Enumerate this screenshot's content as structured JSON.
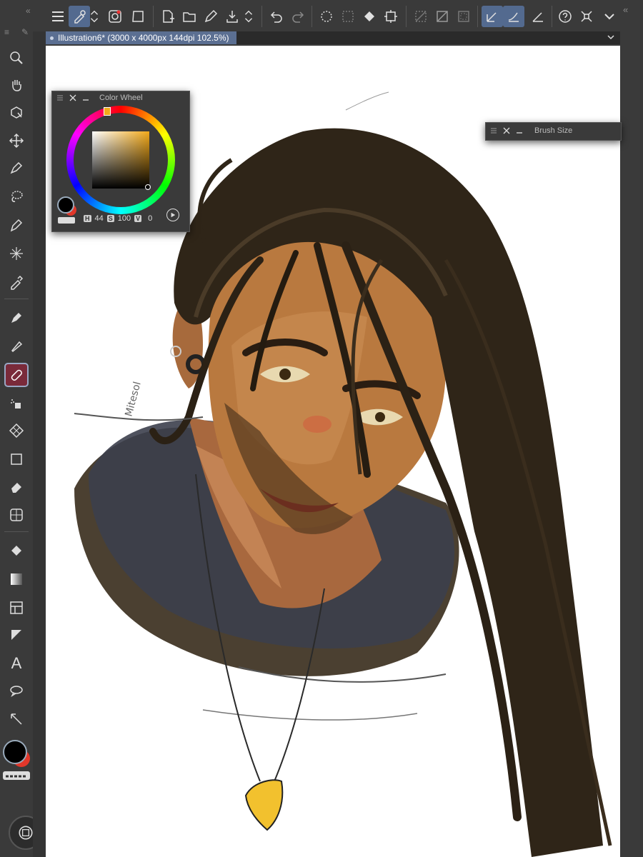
{
  "document": {
    "tab_title": "Illustration6* (3000 x 4000px 144dpi 102.5%)"
  },
  "color_wheel_panel": {
    "title": "Color Wheel",
    "h_key": "H",
    "h_value": "44",
    "s_key": "S",
    "s_value": "100",
    "v_key": "V",
    "v_value": "0",
    "hue_color": "#f2a91a"
  },
  "brush_size_panel": {
    "title": "Brush Size"
  },
  "colors": {
    "main_color": "#000000",
    "sub_color": "#e1372a",
    "active_tool_bg": "#7a2a3a",
    "tab_bg": "#5b6f92",
    "toolbar_bg": "#3a3a3a"
  },
  "top_toolbar_icons": [
    "menu-icon",
    "settings-icon",
    "swap-icon",
    "spiral-icon",
    "transform-icon",
    "new-icon",
    "open-icon",
    "pen-icon",
    "export-icon",
    "chevron-updown-icon",
    "undo-icon",
    "redo-icon",
    "select-all-icon",
    "deselect-icon",
    "fill-icon",
    "crop-icon",
    "hide-selection-icon",
    "invert-icon",
    "border-icon",
    "snap-ruler-icon",
    "snap-special-icon",
    "snap-grid-icon",
    "help-icon",
    "fullscreen-icon",
    "collapse-icon"
  ],
  "left_tools": [
    "zoom-tool",
    "hand-tool",
    "rotate-tool",
    "move-tool",
    "pen-select-tool",
    "lasso-tool",
    "pen-tool",
    "magic-wand-tool",
    "eyedropper-tool",
    "pencil-tool",
    "brush-tool",
    "marker-tool",
    "airbrush-tool",
    "decoration-tool",
    "rect-tool",
    "eraser-tool",
    "mesh-tool",
    "fill-tool",
    "gradient-tool",
    "frame-tool",
    "figure-tool",
    "text-tool",
    "balloon-tool",
    "line-tool"
  ]
}
